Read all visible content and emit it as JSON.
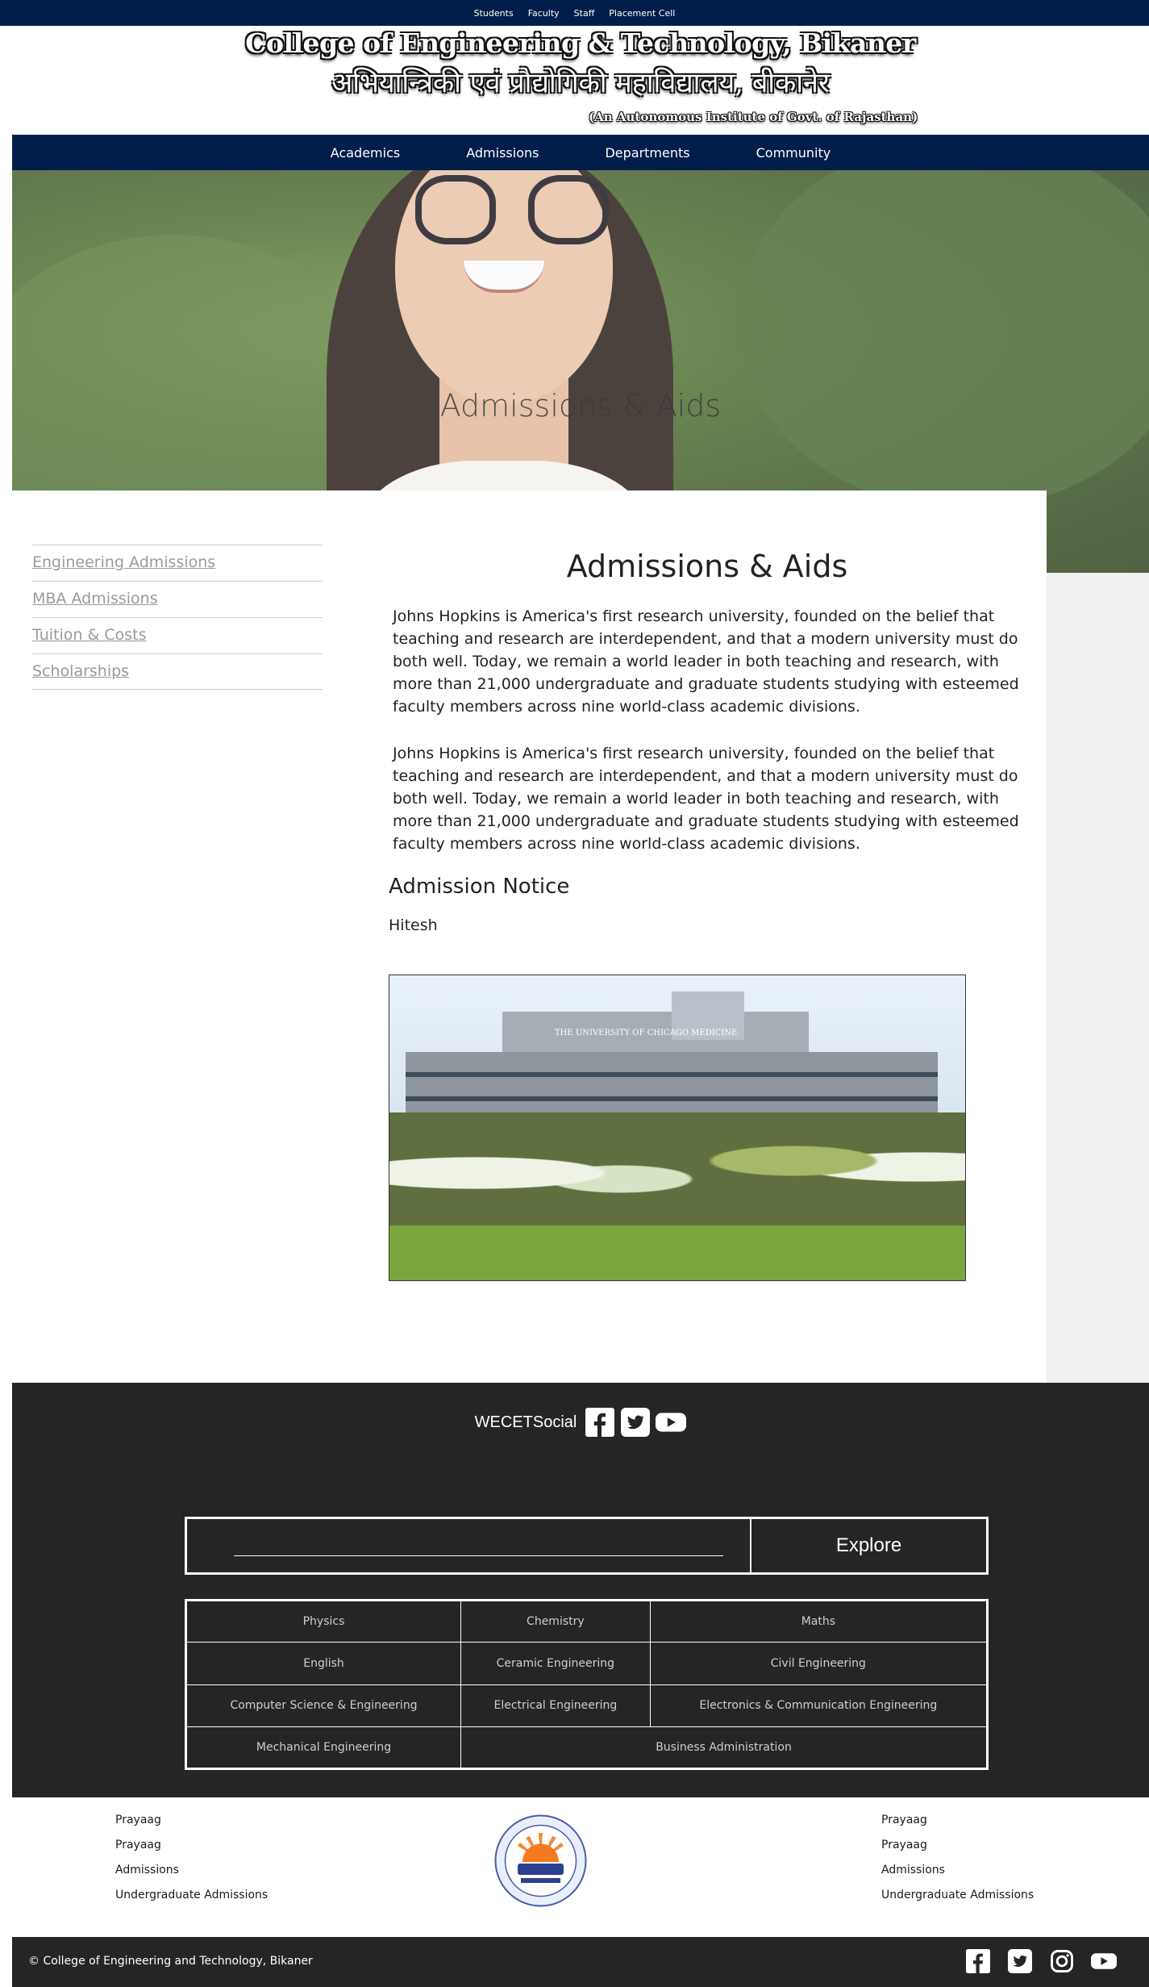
{
  "topbar": {
    "links": [
      "Students",
      "Faculty",
      "Staff",
      "Placement Cell"
    ]
  },
  "masthead": {
    "title_en": "College of Engineering & Technology, Bikaner",
    "title_hi": "अभियान्त्रिकी एवं प्रौद्योगिकी महाविद्यालय, बीकानेर",
    "subtitle": "(An Autonomous Institute of Govt. of Rajasthan)"
  },
  "mainnav": {
    "items": [
      "Academics",
      "Admissions",
      "Departments",
      "Community"
    ]
  },
  "hero": {
    "title": "Admissions & Aids"
  },
  "sidebar": {
    "items": [
      "Engineering Admissions",
      "MBA Admissions",
      "Tuition & Costs",
      "Scholarships"
    ]
  },
  "article": {
    "heading": "Admissions & Aids",
    "paragraphs": [
      "Johns Hopkins is America's first research university, founded on the belief that teaching and research are interdependent, and that a modern university must do both well. Today, we remain a world leader in both teaching and research, with more than 21,000 undergraduate and graduate students studying with esteemed faculty members across nine world-class academic divisions.",
      "Johns Hopkins is America's first research university, founded on the belief that teaching and research are interdependent, and that a modern university must do both well. Today, we remain a world leader in both teaching and research, with more than 21,000 undergraduate and graduate students studying with esteemed faculty members across nine world-class academic divisions."
    ],
    "notice_heading": "Admission Notice",
    "notice_name": "Hitesh",
    "notice_image_sign": "THE UNIVERSITY OF CHICAGO MEDICINE"
  },
  "footer": {
    "social_brand": "WECETSocial",
    "social_icons": [
      "facebook-icon",
      "twitter-icon",
      "youtube-icon"
    ],
    "explore": {
      "placeholder": "",
      "button_label": "Explore"
    },
    "departments": [
      [
        "Physics",
        "Chemistry",
        "Maths"
      ],
      [
        "English",
        "Ceramic Engineering",
        "Civil Engineering"
      ],
      [
        "Computer Science & Engineering",
        "Electrical Engineering",
        "Electronics & Communication Engineering"
      ],
      [
        "Mechanical Engineering",
        "Business Administration"
      ]
    ],
    "left_links": [
      "Prayaag",
      "Prayaag",
      "Admissions",
      "Undergraduate Admissions"
    ],
    "right_links": [
      "Prayaag",
      "Prayaag",
      "Admissions",
      "Undergraduate Admissions"
    ],
    "copyright": "© College of Engineering and Technology, Bikaner",
    "bottom_icons": [
      "facebook-icon",
      "twitter-icon",
      "instagram-icon",
      "youtube-icon"
    ]
  },
  "colors": {
    "navy": "#011e4a",
    "footer_dark": "#252525",
    "sidebar_text": "#9a9a9a"
  }
}
